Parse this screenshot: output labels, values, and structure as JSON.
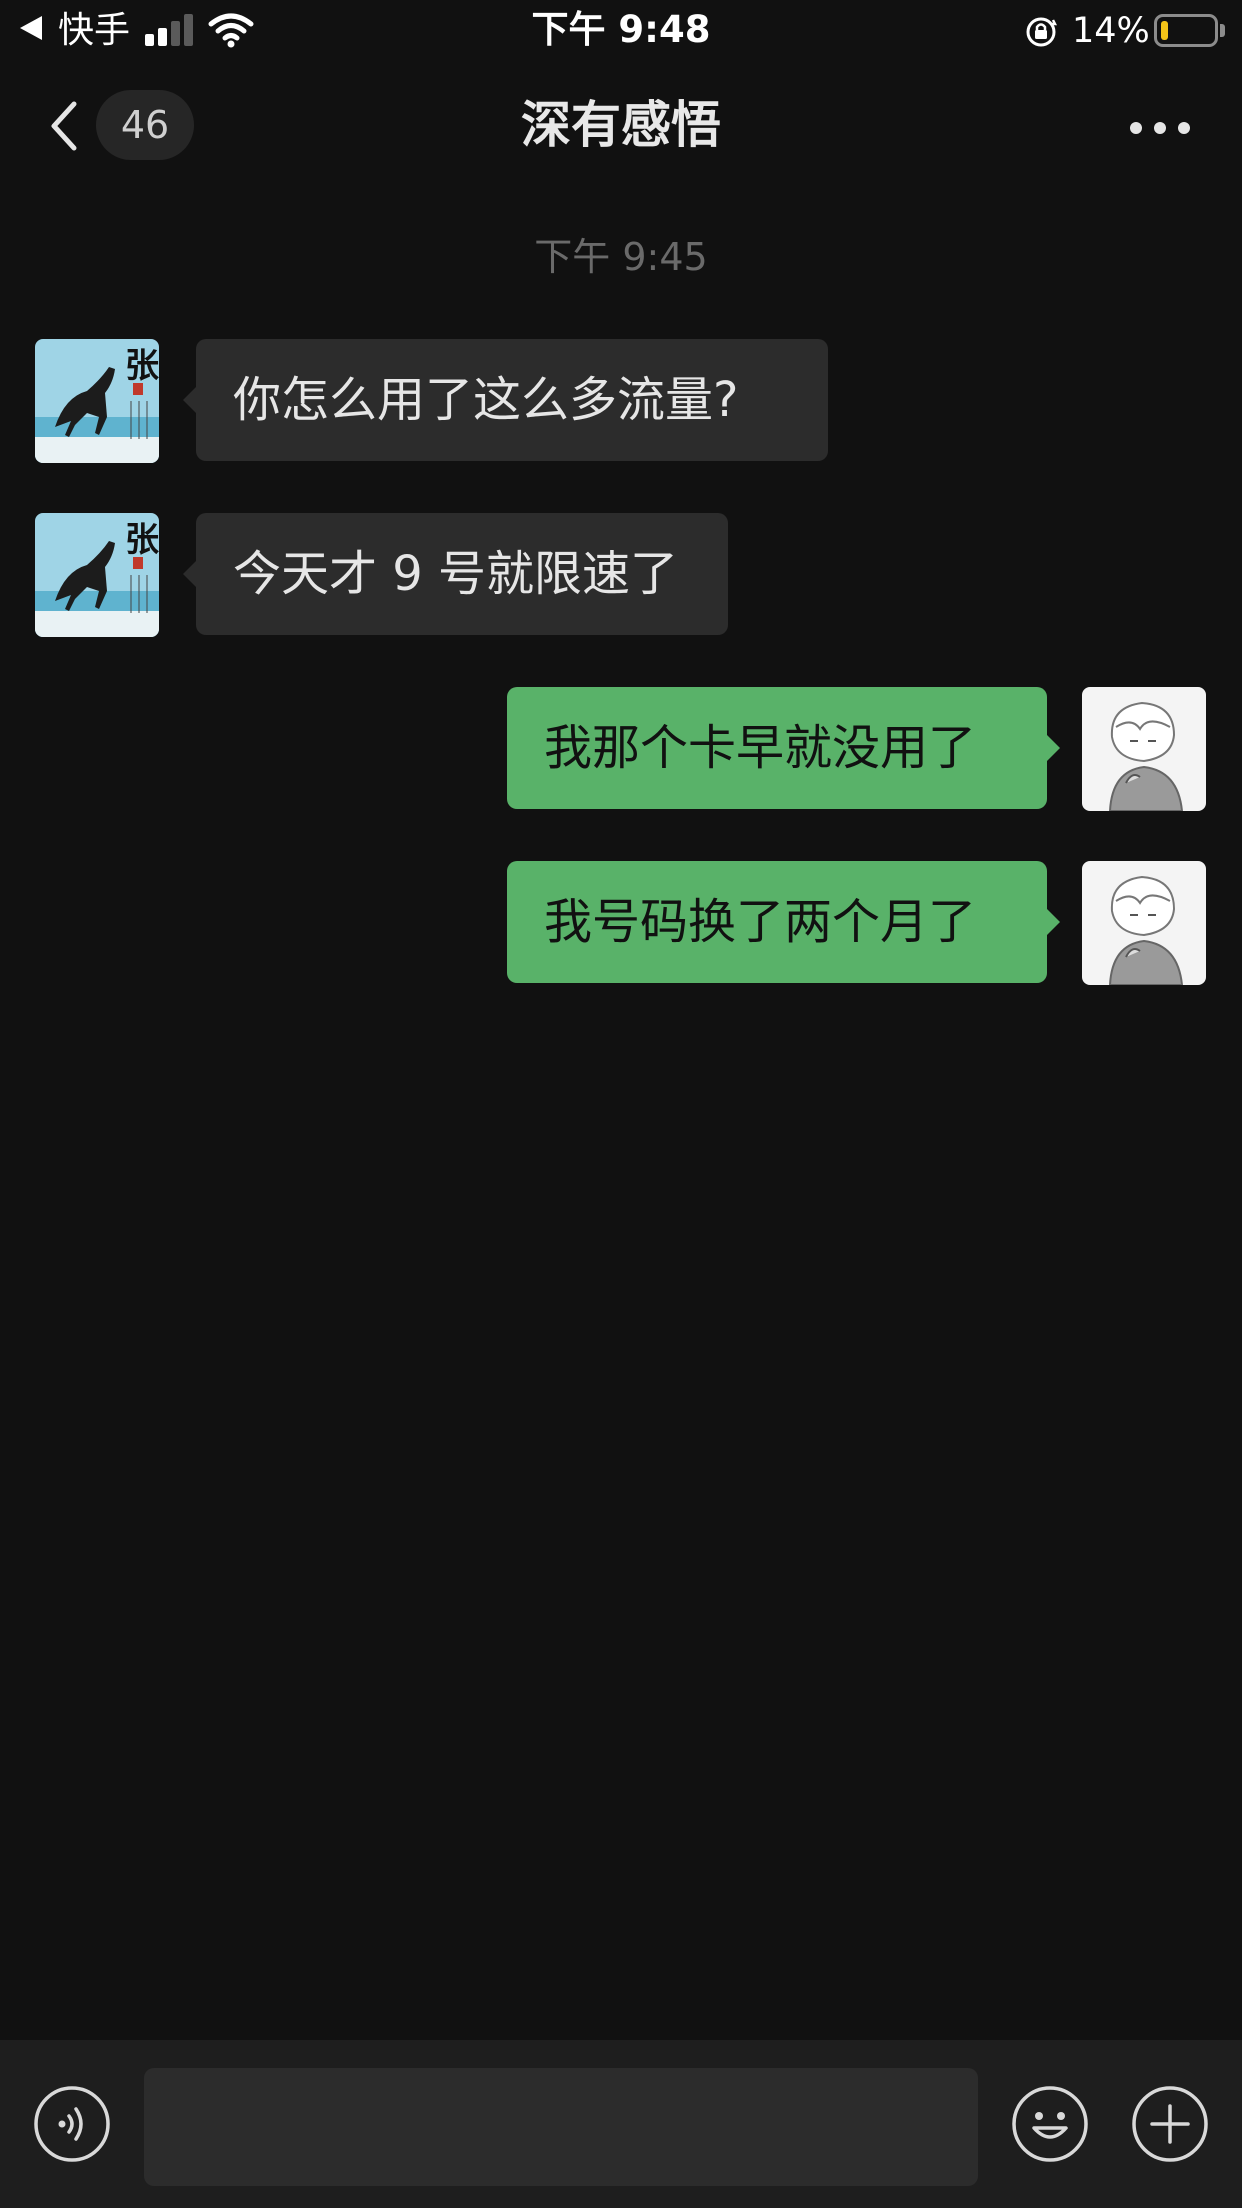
{
  "status_bar": {
    "back_app": "快手",
    "time": "下午 9:48",
    "battery_percent": "14%",
    "battery_level": 0.14,
    "battery_color": "#f5c518",
    "icons": [
      "back-arrow-icon",
      "signal-icon",
      "wifi-icon",
      "orientation-lock-icon",
      "battery-icon"
    ]
  },
  "header": {
    "unread_count": "46",
    "title": "深有感悟",
    "icons": [
      "back-chevron-icon",
      "more-icon"
    ]
  },
  "chat": {
    "timestamp": "下午 9:45",
    "messages": [
      {
        "side": "incoming",
        "text": "你怎么用了这么多流量?"
      },
      {
        "side": "incoming",
        "text": "今天才 9 号就限速了"
      },
      {
        "side": "outgoing",
        "text": "我那个卡早就没用了"
      },
      {
        "side": "outgoing",
        "text": "我号码换了两个月了"
      }
    ]
  },
  "input_bar": {
    "value": "",
    "icons": [
      "voice-icon",
      "emoji-icon",
      "plus-icon"
    ]
  },
  "colors": {
    "background": "#111111",
    "incoming_bubble": "#2c2c2c",
    "outgoing_bubble": "#59b269",
    "input_bar": "#1e1e1e"
  }
}
